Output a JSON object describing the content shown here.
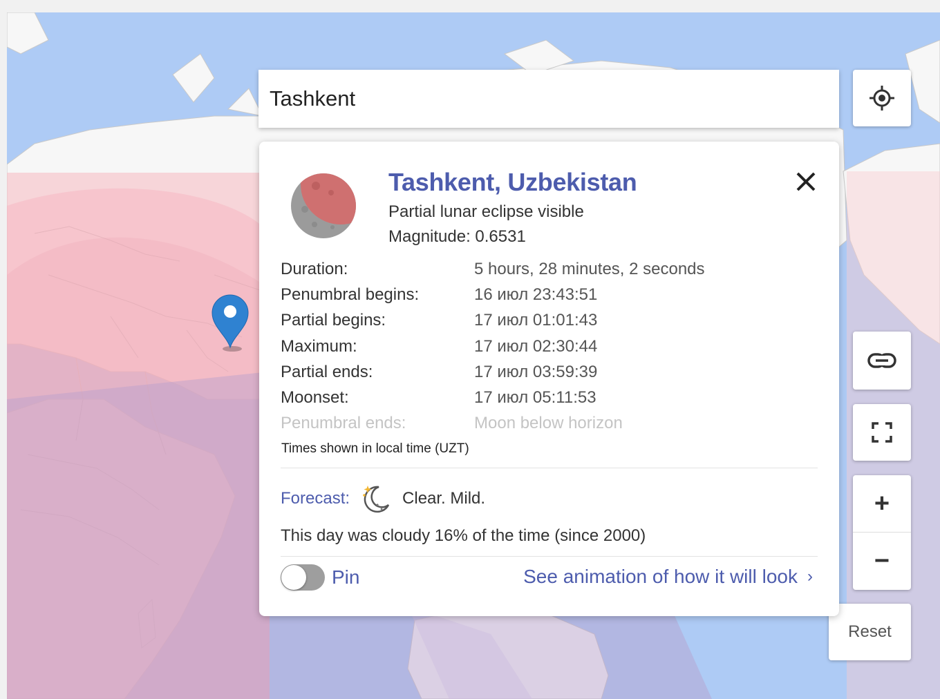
{
  "search": {
    "value": "Tashkent"
  },
  "popup": {
    "title": "Tashkent, Uzbekistan",
    "eclipse_type": "Partial lunar eclipse visible",
    "magnitude": "Magnitude: 0.6531",
    "rows": [
      {
        "label": "Duration:",
        "value": "5 hours, 28 minutes, 2 seconds",
        "dimmed": false
      },
      {
        "label": "Penumbral begins:",
        "value": "16 июл 23:43:51",
        "dimmed": false
      },
      {
        "label": "Partial begins:",
        "value": "17 июл 01:01:43",
        "dimmed": false
      },
      {
        "label": "Maximum:",
        "value": "17 июл 02:30:44",
        "dimmed": false
      },
      {
        "label": "Partial ends:",
        "value": "17 июл 03:59:39",
        "dimmed": false
      },
      {
        "label": "Moonset:",
        "value": "17 июл 05:11:53",
        "dimmed": false
      },
      {
        "label": "Penumbral ends:",
        "value": "Moon below horizon",
        "dimmed": true
      }
    ],
    "timezone_note": "Times shown in local time (UZT)",
    "forecast_label": "Forecast:",
    "forecast_icon": "clear-night-moon-icon",
    "forecast_text": "Clear. Mild.",
    "cloudy_text": "This day was cloudy 16% of the time (since 2000)",
    "pin_label": "Pin",
    "pin_on": false,
    "animation_link": "See animation of how it will look",
    "animation_chevron": "›"
  },
  "controls": {
    "locate_icon": "locate-crosshair-icon",
    "link_icon": "link-icon",
    "fullscreen_icon": "fullscreen-icon",
    "zoom_in": "+",
    "zoom_out": "−",
    "reset": "Reset"
  },
  "colors": {
    "ocean": "#aecbf5",
    "land": "#f7f7f7",
    "penumbral_overlay": "#f8cdd0",
    "partial_overlay": "#d8b6d6",
    "accent": "#4d5cad",
    "marker": "#2f82d1",
    "moon_shadow": "#d76f6f"
  }
}
